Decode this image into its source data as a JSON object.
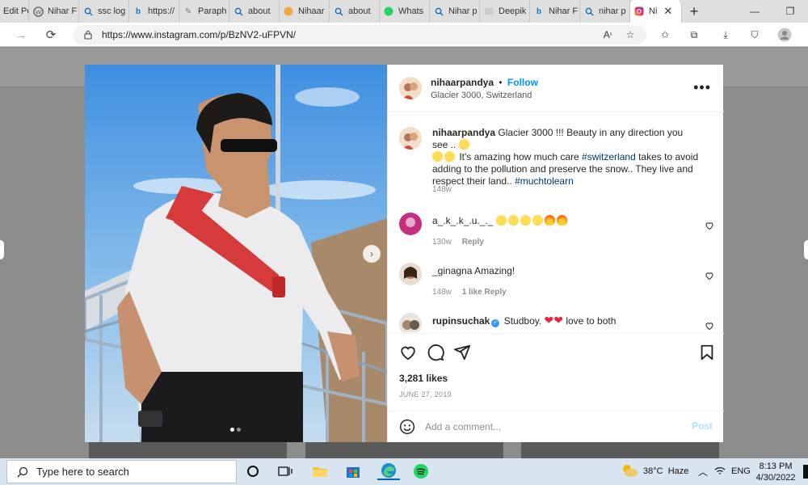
{
  "browser": {
    "tabs": [
      {
        "label": "Edit Po",
        "icon": "wordpress-icon"
      },
      {
        "label": "Nihar F",
        "icon": "wordpress-icon"
      },
      {
        "label": "ssc log",
        "icon": "search-icon"
      },
      {
        "label": "https://",
        "icon": "bing-icon"
      },
      {
        "label": "Paraph",
        "icon": "quill-icon"
      },
      {
        "label": "about",
        "icon": "search-icon"
      },
      {
        "label": "Nihaar",
        "icon": "globe-icon"
      },
      {
        "label": "about",
        "icon": "search-icon"
      },
      {
        "label": "Whats",
        "icon": "whatsapp-icon"
      },
      {
        "label": "Nihar p",
        "icon": "search-icon"
      },
      {
        "label": "Deepik",
        "icon": "page-icon"
      },
      {
        "label": "Nihar F",
        "icon": "bing-icon"
      },
      {
        "label": "nihar p",
        "icon": "search-icon"
      },
      {
        "label": "Ni",
        "icon": "instagram-icon",
        "active": true
      }
    ],
    "url": "https://www.instagram.com/p/BzNV2-uFPVN/"
  },
  "post": {
    "username": "nihaarpandya",
    "follow_label": "Follow",
    "bullet": "•",
    "location": "Glacier 3000, Switzerland",
    "more_label": "•••",
    "caption_part1": "Glacier 3000 !!! Beauty in any direction you see ..",
    "caption_part2": "It's amazing how much care",
    "caption_tag1": "#switzerland",
    "caption_part3": "takes to avoid adding to the pollution and preserve the snow.. They live and respect their land..",
    "caption_tag2": "#muchtolearn",
    "caption_time": "148w",
    "comments": [
      {
        "user": "a_.k_.k_.u._._",
        "text": "",
        "time": "130w",
        "likes": "",
        "reply": "Reply"
      },
      {
        "user": "_ginagna",
        "text": "Amazing!",
        "time": "148w",
        "likes": "1 like",
        "reply": "Reply"
      },
      {
        "user": "rupinsuchak",
        "text_before": "Studboy.",
        "text_after": "love to both",
        "verified_mark": "✓"
      }
    ],
    "likes": "3,281 likes",
    "date": "JUNE 27, 2019",
    "comment_placeholder": "Add a comment...",
    "post_button": "Post",
    "carousel": {
      "total_images": 2,
      "current_index": 1
    }
  },
  "taskbar": {
    "search_placeholder": "Type here to search",
    "weather_temp": "38°C",
    "weather_label": "Haze",
    "language": "ENG",
    "time": "8:13 PM",
    "date": "4/30/2022"
  },
  "colors": {
    "follow_blue": "#0095f6",
    "hashtag": "#00376b",
    "post_disabled": "#b2dffc",
    "taskbar": "#d9e4f1"
  }
}
